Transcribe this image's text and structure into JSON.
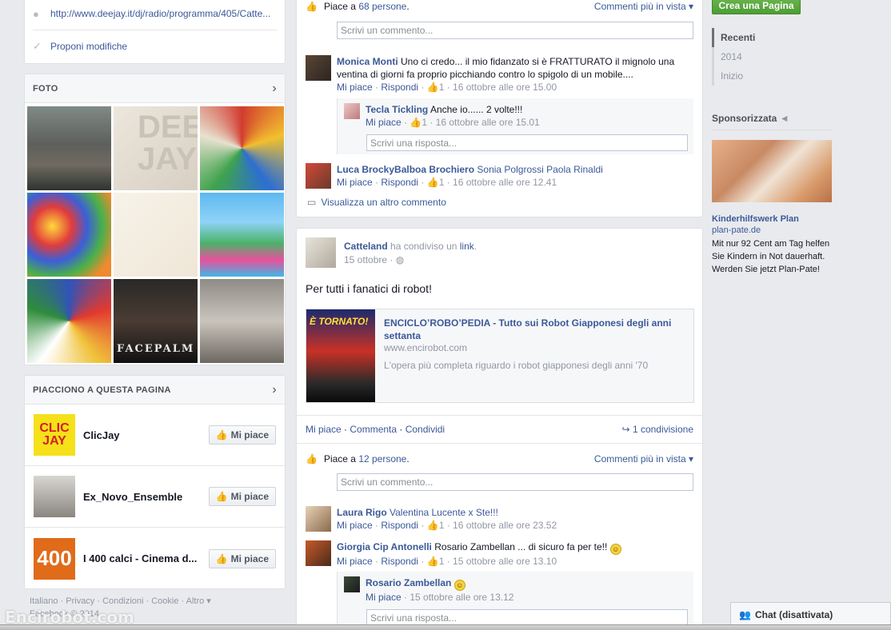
{
  "about": {
    "url": "http://www.deejay.it/dj/radio/programma/405/Catte...",
    "suggest_edits": "Proponi modifiche"
  },
  "photos": {
    "title": "FOTO",
    "facepalm_caption": "FACEPALM"
  },
  "liked_pages": {
    "title": "PIACCIONO A QUESTA PAGINA",
    "button_label": "Mi piace",
    "items": [
      {
        "name": "ClicJay",
        "logo_text": "CLIC JAY"
      },
      {
        "name": "Ex_Novo_Ensemble",
        "logo_text": ""
      },
      {
        "name": "I 400 calci - Cinema d...",
        "logo_text": "400"
      }
    ]
  },
  "footer": {
    "links": "Italiano · Privacy · Condizioni · Cookie · Altro ▾",
    "copyright": "Facebook © 2014"
  },
  "watermark": "Encirobot.com",
  "post1": {
    "likes_text": "Piace a ",
    "likes_count": "68 persone",
    "likes_suffix": ".",
    "sort_label": "Commenti più in vista ▾",
    "comment_placeholder": "Scrivi un commento...",
    "comments": [
      {
        "author": "Monica Monti",
        "text": "Uno ci credo... il mio fidanzato si è FRATTURATO il mignolo una ventina di giorni fa proprio picchiando contro lo spigolo di un mobile....",
        "like": "Mi piace",
        "reply": "Rispondi",
        "likes": "1",
        "time": "16 ottobre alle ore 15.00"
      },
      {
        "author": "Tecla Tickling",
        "text": "Anche io...... 2 volte!!!",
        "like": "Mi piace",
        "likes": "1",
        "time": "16 ottobre alle ore 15.01"
      },
      {
        "author": "Luca BrockyBalboa Brochiero",
        "text": "Sonia Polgrossi Paola Rinaldi",
        "like": "Mi piace",
        "reply": "Rispondi",
        "likes": "1",
        "time": "16 ottobre alle ore 12.41"
      }
    ],
    "reply_placeholder": "Scrivi una risposta...",
    "more_comments": "Visualizza un altro commento"
  },
  "post2": {
    "author": "Catteland",
    "shared_text": " ha condiviso un ",
    "shared_link": "link",
    "shared_suffix": ".",
    "date": "15 ottobre",
    "message": "Per tutti i fanatici di robot!",
    "link": {
      "title": "ENCICLO’ROBO’PEDIA - Tutto sui Robot Giapponesi degli anni settanta",
      "host": "www.encirobot.com",
      "description": "L'opera più completa riguardo i robot giapponesi degli anni '70",
      "image_text": "È TORNATO!"
    },
    "actions": {
      "like": "Mi piace",
      "comment": "Commenta",
      "share": "Condividi",
      "shares": "1 condivisione"
    },
    "likes_text": "Piace a ",
    "likes_count": "12 persone",
    "likes_suffix": ".",
    "sort_label": "Commenti più in vista ▾",
    "comment_placeholder": "Scrivi un commento...",
    "comments": [
      {
        "author": "Laura Rigo",
        "text": "Valentina Lucente x Ste!!!",
        "like": "Mi piace",
        "reply": "Rispondi",
        "likes": "1",
        "time": "16 ottobre alle ore 23.52"
      },
      {
        "author": "Giorgia Cip Antonelli",
        "text": "Rosario Zambellan ... di sicuro fa per te!!",
        "like": "Mi piace",
        "reply": "Rispondi",
        "likes": "1",
        "time": "15 ottobre alle ore 13.10"
      },
      {
        "author": "Rosario Zambellan",
        "text": "",
        "like": "Mi piace",
        "time": "15 ottobre alle ore 13.12"
      }
    ],
    "reply_placeholder": "Scrivi una risposta..."
  },
  "sidebar": {
    "create_page": "Crea una Pagina",
    "years": [
      "Recenti",
      "2014",
      "Inizio"
    ],
    "sponsored_title": "Sponsorizzata",
    "ad": {
      "title": "Kinderhilfswerk Plan",
      "host": "plan-pate.de",
      "text": "Mit nur 92 Cent am Tag helfen Sie Kindern in Not dauerhaft. Werden Sie jetzt Plan-Pate!"
    }
  },
  "chat": {
    "label": "Chat (disattivata)"
  },
  "colors": {
    "link": "#3b5998",
    "muted": "#9197a3",
    "create_button": "#4d9d35",
    "background": "#e9eaed"
  }
}
